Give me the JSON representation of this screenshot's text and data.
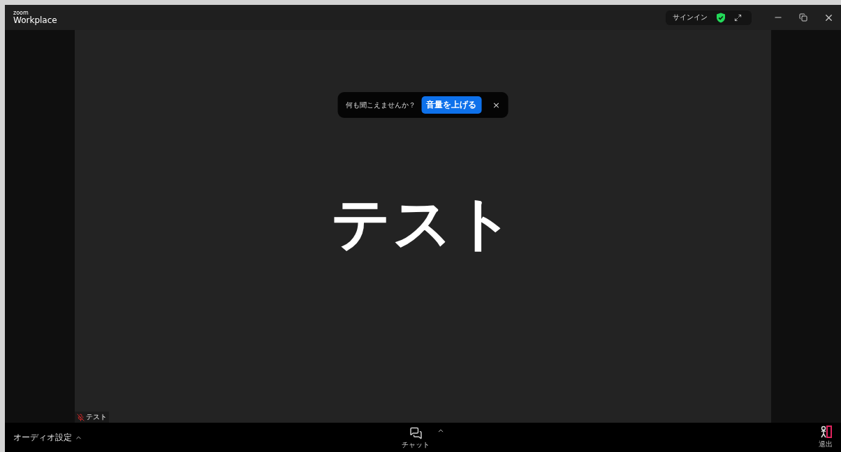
{
  "title_bar": {
    "brand": "zoom",
    "product": "Workplace",
    "sign_in": "サインイン"
  },
  "notification": {
    "text": "何も聞こえませんか？",
    "button": "音量を上げる",
    "close": "×"
  },
  "main_text": "テスト",
  "participant": {
    "name": "テスト",
    "muted": true
  },
  "toolbar": {
    "audio_settings": "オーディオ設定",
    "chat": "チャット",
    "leave": "退出"
  }
}
